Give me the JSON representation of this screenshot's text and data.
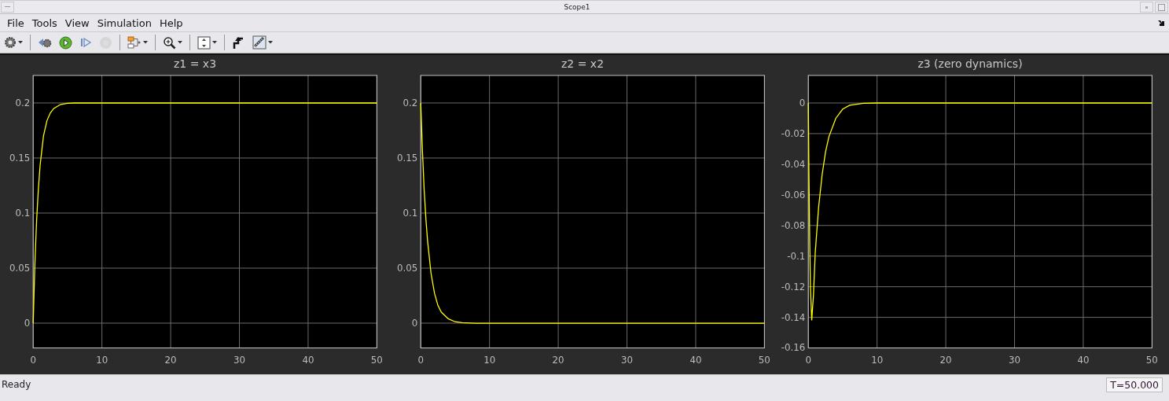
{
  "window": {
    "title": "Scope1"
  },
  "menu": [
    "File",
    "Tools",
    "View",
    "Simulation",
    "Help"
  ],
  "toolbar": [
    {
      "kind": "gear",
      "caret": true,
      "disabled": false
    },
    {
      "kind": "sep"
    },
    {
      "kind": "step-back",
      "caret": false,
      "disabled": false
    },
    {
      "kind": "run",
      "caret": false,
      "disabled": false
    },
    {
      "kind": "step-forward",
      "caret": false,
      "disabled": false
    },
    {
      "kind": "stop",
      "caret": false,
      "disabled": true
    },
    {
      "kind": "sep"
    },
    {
      "kind": "highlight",
      "caret": true,
      "disabled": false
    },
    {
      "kind": "sep"
    },
    {
      "kind": "zoom",
      "caret": true,
      "disabled": false
    },
    {
      "kind": "sep"
    },
    {
      "kind": "autoscale",
      "caret": true,
      "disabled": false
    },
    {
      "kind": "sep"
    },
    {
      "kind": "trigger",
      "caret": false,
      "disabled": false
    },
    {
      "kind": "ruler",
      "caret": true,
      "disabled": false
    }
  ],
  "plots": [
    {
      "chart_data": {
        "type": "line",
        "title": "z1 = x3",
        "x": [
          0,
          0.25,
          0.5,
          0.75,
          1,
          1.5,
          2,
          2.5,
          3,
          4,
          5,
          6,
          8,
          10,
          20,
          30,
          40,
          50
        ],
        "grid": true,
        "series": [
          {
            "color": "#ffff00",
            "values": [
              0,
              0.054,
              0.093,
              0.122,
              0.143,
              0.17,
              0.184,
              0.191,
              0.195,
              0.1987,
              0.1996,
              0.2,
              0.2,
              0.2,
              0.2,
              0.2,
              0.2,
              0.2
            ]
          }
        ],
        "xlim": [
          0,
          50
        ],
        "ylim": [
          -0.0225,
          0.225
        ],
        "xticks": [
          0,
          10,
          20,
          30,
          40,
          50
        ],
        "yticks": [
          0,
          0.05,
          0.1,
          0.15,
          0.2
        ]
      }
    },
    {
      "chart_data": {
        "type": "line",
        "title": "z2 = x2",
        "x": [
          0,
          0.25,
          0.5,
          0.75,
          1,
          1.5,
          2,
          2.5,
          3,
          4,
          5,
          6,
          8,
          10,
          20,
          30,
          40,
          50
        ],
        "grid": true,
        "series": [
          {
            "color": "#ffff00",
            "values": [
              0.2,
              0.156,
              0.121,
              0.094,
              0.074,
              0.045,
              0.027,
              0.016,
              0.01,
              0.004,
              0.0013,
              0.0005,
              0,
              0,
              0,
              0,
              0,
              0
            ]
          }
        ],
        "xlim": [
          0,
          50
        ],
        "ylim": [
          -0.0225,
          0.225
        ],
        "xticks": [
          0,
          10,
          20,
          30,
          40,
          50
        ],
        "yticks": [
          0,
          0.05,
          0.1,
          0.15,
          0.2
        ]
      }
    },
    {
      "chart_data": {
        "type": "line",
        "title": "z3 (zero dynamics)",
        "x": [
          0,
          0.1,
          0.2,
          0.3,
          0.5,
          0.75,
          1,
          1.5,
          2,
          2.5,
          3,
          4,
          5,
          6,
          8,
          10,
          20,
          30,
          40,
          50
        ],
        "grid": true,
        "series": [
          {
            "color": "#ffff00",
            "values": [
              0,
              -0.05,
              -0.09,
              -0.12,
              -0.142,
              -0.125,
              -0.098,
              -0.068,
              -0.047,
              -0.032,
              -0.022,
              -0.01,
              -0.004,
              -0.0015,
              -0.0002,
              0,
              0,
              0,
              0,
              0
            ]
          }
        ],
        "xlim": [
          0,
          50
        ],
        "ylim": [
          -0.16,
          0.018
        ],
        "xticks": [
          0,
          10,
          20,
          30,
          40,
          50
        ],
        "yticks": [
          {
            "value": 0,
            "label": "0"
          },
          {
            "value": -0.02,
            "label": "-0.02"
          },
          {
            "value": -0.04,
            "label": "-0.04"
          },
          {
            "value": -0.06,
            "label": "-0.06"
          },
          {
            "value": -0.08,
            "label": "-0.08"
          },
          {
            "value": -0.1,
            "label": "-0.1"
          },
          {
            "value": -0.12,
            "label": "-0.12"
          },
          {
            "value": -0.14,
            "label": "-0.14"
          },
          {
            "value": -0.16,
            "label": "-0.16"
          }
        ]
      }
    }
  ],
  "status_bar": {
    "message": "Ready",
    "time": "T=50.000"
  }
}
